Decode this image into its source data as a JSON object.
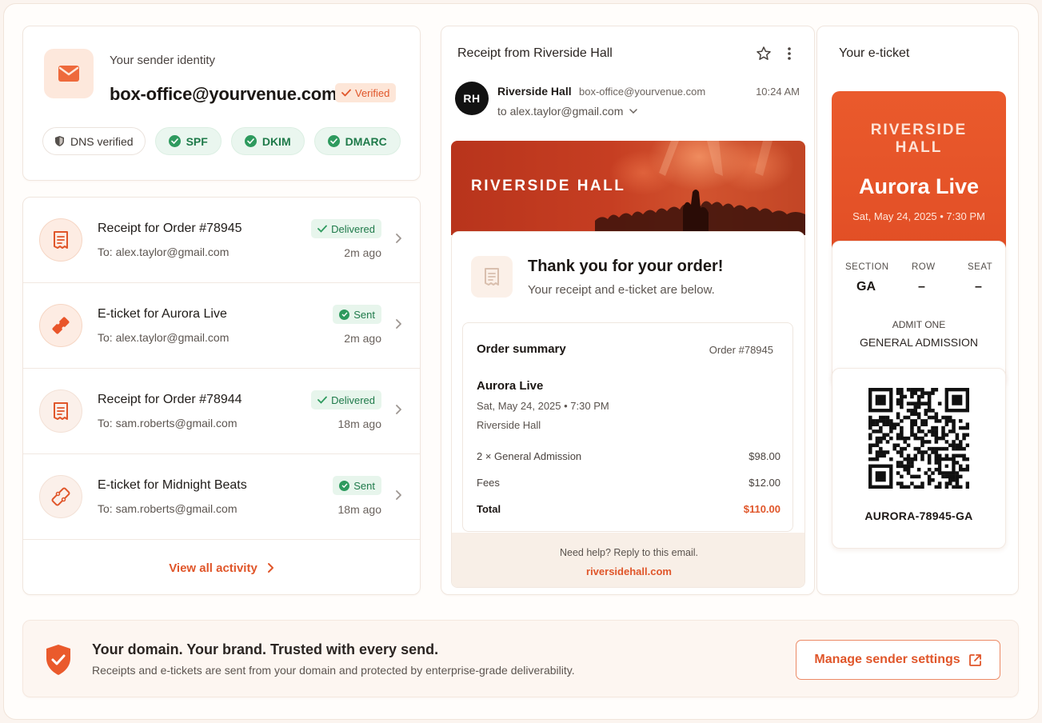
{
  "identity": {
    "label": "Your sender identity",
    "email": "box-office@yourvenue.com",
    "verified_badge": "Verified",
    "chips": {
      "dns": "DNS verified",
      "spf": "SPF",
      "dkim": "DKIM",
      "dmarc": "DMARC"
    }
  },
  "activity": {
    "items": [
      {
        "title": "Receipt for Order #78945",
        "to": "To: alex.taylor@gmail.com",
        "status": "Delivered",
        "time": "2m ago",
        "icon": "receipt-icon"
      },
      {
        "title": "E-ticket for Aurora Live",
        "to": "To: alex.taylor@gmail.com",
        "status": "Sent",
        "time": "2m ago",
        "icon": "ticket-icon"
      },
      {
        "title": "Receipt for Order #78944",
        "to": "To: sam.roberts@gmail.com",
        "status": "Delivered",
        "time": "18m ago",
        "icon": "receipt-icon"
      },
      {
        "title": "E-ticket for Midnight Beats",
        "to": "To: sam.roberts@gmail.com",
        "status": "Sent",
        "time": "18m ago",
        "icon": "ticket-icon"
      }
    ],
    "view_all": "View all activity"
  },
  "email": {
    "subject": "Receipt from Riverside Hall",
    "avatar_initials": "RH",
    "from_name": "Riverside Hall",
    "from_address": "box-office@yourvenue.com",
    "time": "10:24 AM",
    "to": "to alex.taylor@gmail.com",
    "banner_title": "RIVERSIDE HALL",
    "thank_title": "Thank you for your order!",
    "thank_sub": "Your receipt and e-ticket are below.",
    "summary": {
      "title": "Order summary",
      "order_no": "Order #78945",
      "event": "Aurora Live",
      "date": "Sat, May 24, 2025 • 7:30 PM",
      "venue": "Riverside Hall",
      "lines": [
        {
          "label": "2 × General Admission",
          "amount": "$98.00"
        },
        {
          "label": "Fees",
          "amount": "$12.00"
        },
        {
          "label": "Total",
          "amount": "$110.00"
        }
      ]
    },
    "footer_help": "Need help? Reply to this email.",
    "footer_link": "riversidehall.com"
  },
  "ticket": {
    "label": "Your e-ticket",
    "venue_line1": "RIVERSIDE",
    "venue_line2": "HALL",
    "event": "Aurora Live",
    "date": "Sat, May 24, 2025 • 7:30 PM",
    "section_label": "SECTION",
    "section_value": "GA",
    "row_label": "ROW",
    "row_value": "–",
    "seat_label": "SEAT",
    "seat_value": "–",
    "admit_label": "ADMIT ONE",
    "admit_value": "GENERAL ADMISSION",
    "code": "AURORA-78945-GA"
  },
  "brandbar": {
    "title": "Your domain. Your brand. Trusted with every send.",
    "subtitle": "Receipts and e-tickets are sent from your domain and protected by enterprise-grade deliverability.",
    "button": "Manage sender settings"
  },
  "colors": {
    "accent": "#e0562a",
    "success": "#2e9a5e",
    "ticket": "#e8552a"
  }
}
